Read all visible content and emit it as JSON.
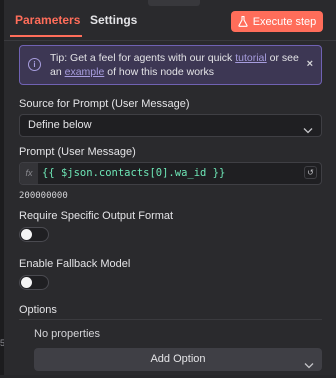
{
  "tabs": [
    {
      "label": "Parameters",
      "active": true
    },
    {
      "label": "Settings",
      "active": false
    }
  ],
  "execute_button": {
    "label": "Execute step",
    "icon": "flask-icon",
    "color": "#ff6d5a"
  },
  "callout": {
    "prefix": "Tip: Get a feel for agents with our quick ",
    "link1": "tutorial",
    "middle": " or see an ",
    "link2": "example",
    "suffix": " of how this node works",
    "icon": "info-icon",
    "close": "×"
  },
  "source_prompt": {
    "label": "Source for Prompt (User Message)",
    "value": "Define below"
  },
  "prompt": {
    "label": "Prompt (User Message)",
    "fx_badge": "fx",
    "expression": "{{ $json.contacts[0].wa_id }}",
    "preview": "200000000"
  },
  "require_output_format": {
    "label": "Require Specific Output Format",
    "enabled": false
  },
  "enable_fallback": {
    "label": "Enable Fallback Model",
    "enabled": false
  },
  "options": {
    "heading": "Options",
    "empty_text": "No properties",
    "add_button": "Add Option"
  },
  "edge_digit": "5",
  "colors": {
    "accent": "#ff6d5a",
    "callout_bg": "#3d3754",
    "callout_border": "#7062b3",
    "code": "#6ee7b7"
  }
}
